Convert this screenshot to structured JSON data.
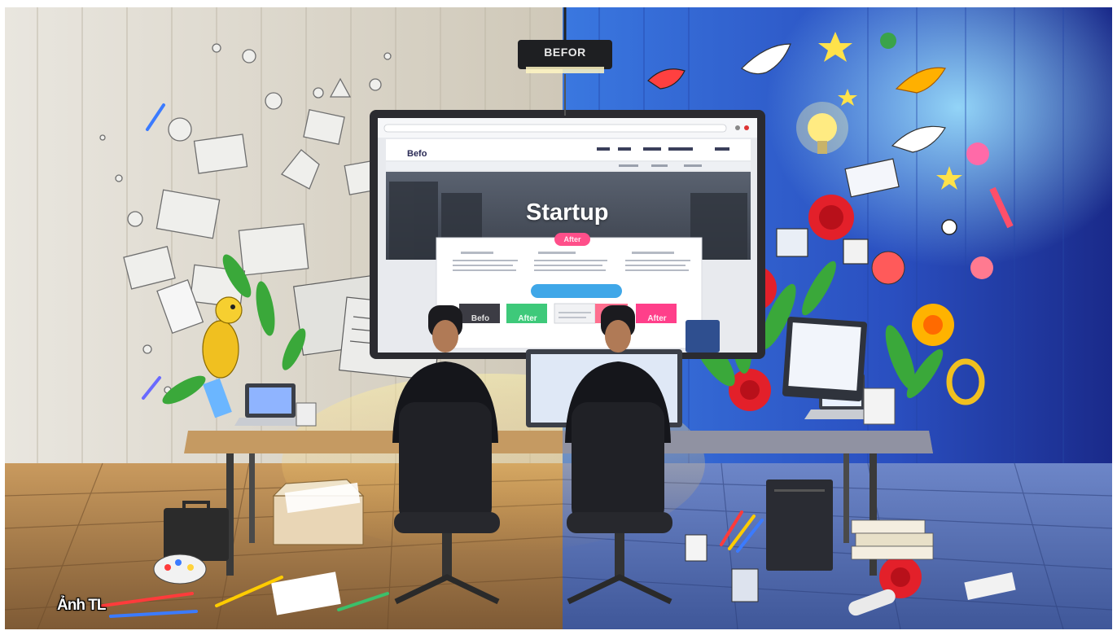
{
  "sign": {
    "text": "BEFOR"
  },
  "screen": {
    "brand": "Befo",
    "hero_title": "Startup",
    "hero_badge": "After",
    "buttons": [
      "Befo",
      "After",
      "",
      "",
      "After"
    ]
  },
  "credit": {
    "text": "Ảnh TL"
  },
  "colors": {
    "left_wall": "#d9d4c8",
    "right_wall": "#2c55c9",
    "floor_left": "#a2784a",
    "floor_right": "#5874b8",
    "accent_pink": "#ff4f8a",
    "accent_green": "#3ec97a",
    "accent_blue": "#3fa7e8",
    "suit": "#15161b"
  }
}
